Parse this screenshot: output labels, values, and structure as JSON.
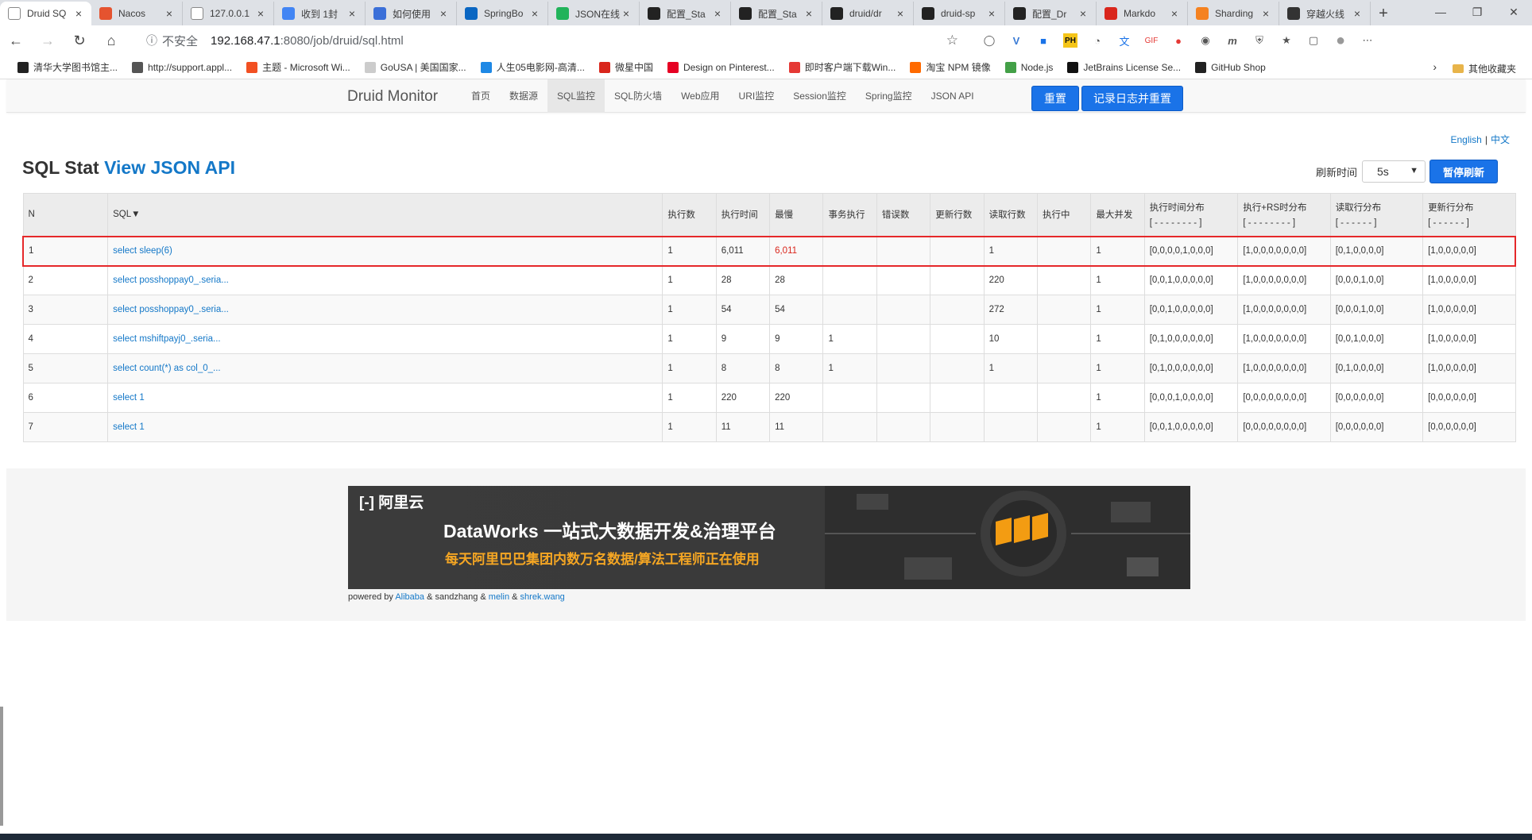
{
  "browser": {
    "tabs": [
      {
        "title": "Druid SQ",
        "icon": "doc-icon",
        "color": "#ffffff",
        "active": true
      },
      {
        "title": "Nacos",
        "icon": "nacos-icon",
        "color": "#e5532f"
      },
      {
        "title": "127.0.0.1",
        "icon": "doc-icon",
        "color": "#ffffff"
      },
      {
        "title": "收到 1封",
        "icon": "chrome-icon",
        "color": "#4285f4"
      },
      {
        "title": "如何使用",
        "icon": "link-icon",
        "color": "#3b6fd8"
      },
      {
        "title": "SpringBo",
        "icon": "zhihu-icon",
        "color": "#0a66c2"
      },
      {
        "title": "JSON在线",
        "icon": "json-icon",
        "color": "#21b35a"
      },
      {
        "title": "配置_Sta",
        "icon": "github-icon",
        "color": "#222222"
      },
      {
        "title": "配置_Sta",
        "icon": "github-icon",
        "color": "#222222"
      },
      {
        "title": "druid/dr",
        "icon": "github-icon",
        "color": "#222222"
      },
      {
        "title": "druid-sp",
        "icon": "github-icon",
        "color": "#222222"
      },
      {
        "title": "配置_Dr",
        "icon": "github-icon",
        "color": "#222222"
      },
      {
        "title": "Markdo",
        "icon": "csdn-icon",
        "color": "#d9261c"
      },
      {
        "title": "Sharding",
        "icon": "firefox-icon",
        "color": "#f58220"
      },
      {
        "title": "穿越火线",
        "icon": "game-icon",
        "color": "#333333"
      }
    ],
    "new_tab": "+",
    "address": {
      "insecure": "不安全",
      "host": "192.168.47.1",
      "path": ":8080/job/druid/sql.html"
    },
    "bookmarks": [
      {
        "label": "清华大学图书馆主...",
        "color": "#222222"
      },
      {
        "label": "http://support.appl...",
        "color": "#555555"
      },
      {
        "label": "主题 - Microsoft Wi...",
        "color": "#f25022"
      },
      {
        "label": "GoUSA | 美国国家...",
        "color": "#cccccc"
      },
      {
        "label": "人生05电影网-高清...",
        "color": "#1e88e5"
      },
      {
        "label": "微星中国",
        "color": "#d9261c"
      },
      {
        "label": "Design on Pinterest...",
        "color": "#e60023"
      },
      {
        "label": "即时客户端下载Win...",
        "color": "#e53935"
      },
      {
        "label": "淘宝 NPM 镜像",
        "color": "#ff6a00"
      },
      {
        "label": "Node.js",
        "color": "#43a047"
      },
      {
        "label": "JetBrains License Se...",
        "color": "#111111"
      },
      {
        "label": "GitHub Shop",
        "color": "#222222"
      }
    ],
    "bookmarks_other": "其他收藏夹"
  },
  "druid": {
    "brand": "Druid Monitor",
    "nav": [
      "首页",
      "数据源",
      "SQL监控",
      "SQL防火墙",
      "Web应用",
      "URI监控",
      "Session监控",
      "Spring监控",
      "JSON API"
    ],
    "active_nav": "SQL监控",
    "btn_reset": "重置",
    "btn_log_reset": "记录日志并重置",
    "lang_en": "English",
    "lang_zh": "中文",
    "title_prefix": "SQL Stat",
    "title_link": "View JSON API",
    "refresh_label": "刷新时间",
    "refresh_value": "5s",
    "pause_button": "暂停刷新",
    "table": {
      "headers": [
        "N",
        "SQL▼",
        "执行数",
        "执行时间",
        "最慢",
        "事务执行",
        "错误数",
        "更新行数",
        "读取行数",
        "执行中",
        "最大并发"
      ],
      "dist_headers": [
        {
          "label": "执行时间分布",
          "sub": "[ - - - - - - - - ]"
        },
        {
          "label": "执行+RS时分布",
          "sub": "[ - - - - - - - - ]"
        },
        {
          "label": "读取行分布",
          "sub": "[ - - - - - - ]"
        },
        {
          "label": "更新行分布",
          "sub": "[ - - - - - - ]"
        }
      ],
      "rows": [
        {
          "n": "1",
          "sql": "select sleep(6)",
          "exec": "1",
          "time": "6,011",
          "slowest": "6,011",
          "tx": "",
          "err": "",
          "upd": "",
          "read": "1",
          "running": "",
          "maxconc": "1",
          "d1": "[0,0,0,0,1,0,0,0]",
          "d2": "[1,0,0,0,0,0,0,0]",
          "d3": "[0,1,0,0,0,0]",
          "d4": "[1,0,0,0,0,0]"
        },
        {
          "n": "2",
          "sql": "select posshoppay0_.seria...",
          "exec": "1",
          "time": "28",
          "slowest": "28",
          "tx": "",
          "err": "",
          "upd": "",
          "read": "220",
          "running": "",
          "maxconc": "1",
          "d1": "[0,0,1,0,0,0,0,0]",
          "d2": "[1,0,0,0,0,0,0,0]",
          "d3": "[0,0,0,1,0,0]",
          "d4": "[1,0,0,0,0,0]"
        },
        {
          "n": "3",
          "sql": "select posshoppay0_.seria...",
          "exec": "1",
          "time": "54",
          "slowest": "54",
          "tx": "",
          "err": "",
          "upd": "",
          "read": "272",
          "running": "",
          "maxconc": "1",
          "d1": "[0,0,1,0,0,0,0,0]",
          "d2": "[1,0,0,0,0,0,0,0]",
          "d3": "[0,0,0,1,0,0]",
          "d4": "[1,0,0,0,0,0]"
        },
        {
          "n": "4",
          "sql": "select mshiftpayj0_.seria...",
          "exec": "1",
          "time": "9",
          "slowest": "9",
          "tx": "1",
          "err": "",
          "upd": "",
          "read": "10",
          "running": "",
          "maxconc": "1",
          "d1": "[0,1,0,0,0,0,0,0]",
          "d2": "[1,0,0,0,0,0,0,0]",
          "d3": "[0,0,1,0,0,0]",
          "d4": "[1,0,0,0,0,0]"
        },
        {
          "n": "5",
          "sql": "select count(*) as col_0_...",
          "exec": "1",
          "time": "8",
          "slowest": "8",
          "tx": "1",
          "err": "",
          "upd": "",
          "read": "1",
          "running": "",
          "maxconc": "1",
          "d1": "[0,1,0,0,0,0,0,0]",
          "d2": "[1,0,0,0,0,0,0,0]",
          "d3": "[0,1,0,0,0,0]",
          "d4": "[1,0,0,0,0,0]"
        },
        {
          "n": "6",
          "sql": "select 1",
          "exec": "1",
          "time": "220",
          "slowest": "220",
          "tx": "",
          "err": "",
          "upd": "",
          "read": "",
          "running": "",
          "maxconc": "1",
          "d1": "[0,0,0,1,0,0,0,0]",
          "d2": "[0,0,0,0,0,0,0,0]",
          "d3": "[0,0,0,0,0,0]",
          "d4": "[0,0,0,0,0,0]"
        },
        {
          "n": "7",
          "sql": "select 1",
          "exec": "1",
          "time": "11",
          "slowest": "11",
          "tx": "",
          "err": "",
          "upd": "",
          "read": "",
          "running": "",
          "maxconc": "1",
          "d1": "[0,0,1,0,0,0,0,0]",
          "d2": "[0,0,0,0,0,0,0,0]",
          "d3": "[0,0,0,0,0,0]",
          "d4": "[0,0,0,0,0,0]"
        }
      ]
    },
    "banner": {
      "logo": "阿里云",
      "title": "DataWorks 一站式大数据开发&治理平台",
      "subtitle": "每天阿里巴巴集团内数万名数据/算法工程师正在使用"
    },
    "powered_prefix": "powered by",
    "powered_alibaba": "Alibaba",
    "powered_sandzhang": "& sandzhang &",
    "powered_melin": "melin",
    "powered_amp": "&",
    "powered_shrek": "shrek.wang"
  }
}
